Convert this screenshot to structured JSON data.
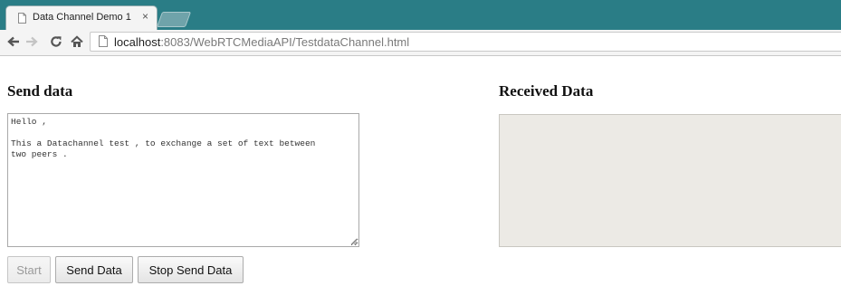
{
  "browser": {
    "tab_title": "Data Channel Demo 1",
    "tab_close": "×",
    "url_host": "localhost",
    "url_rest": ":8083/WebRTCMediaAPI/TestdataChannel.html"
  },
  "send": {
    "heading": "Send data",
    "text": "Hello ,\n\nThis a Datachannel test , to exchange a set of text between\ntwo peers ."
  },
  "receive": {
    "heading": "Received Data",
    "text": ""
  },
  "buttons": {
    "start": "Start",
    "send_data": "Send Data",
    "stop_send_data": "Stop Send Data"
  },
  "colors": {
    "tab_strip": "#2a7d86",
    "received_bg": "#eceae5"
  },
  "icons": {
    "back": "arrow-left",
    "forward": "arrow-right",
    "reload": "reload",
    "home": "home",
    "page": "page",
    "favicon": "page"
  }
}
